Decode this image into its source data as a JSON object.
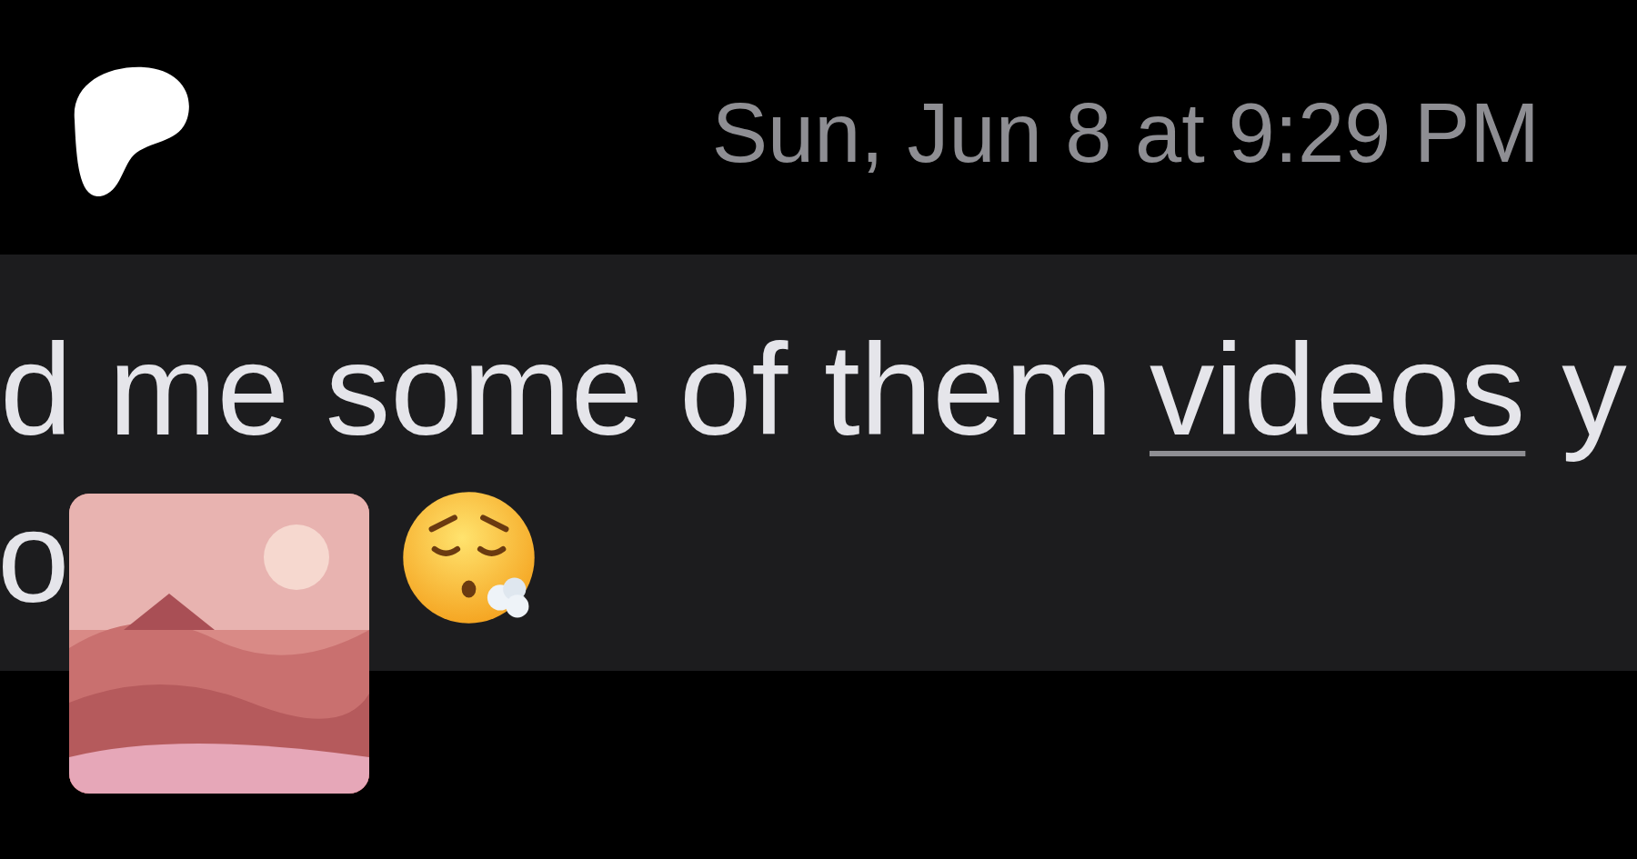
{
  "timestamp": "Sun, Jun 8 at 9:29 PM",
  "message": {
    "lines": [
      {
        "segments": [
          {
            "text": "d me some of them",
            "underlined": false
          },
          {
            "text": "videos",
            "underlined": true
          },
          {
            "text": "y",
            "underlined": false
          }
        ]
      },
      {
        "segments": [
          {
            "text": "o",
            "underlined": false
          }
        ]
      }
    ]
  }
}
